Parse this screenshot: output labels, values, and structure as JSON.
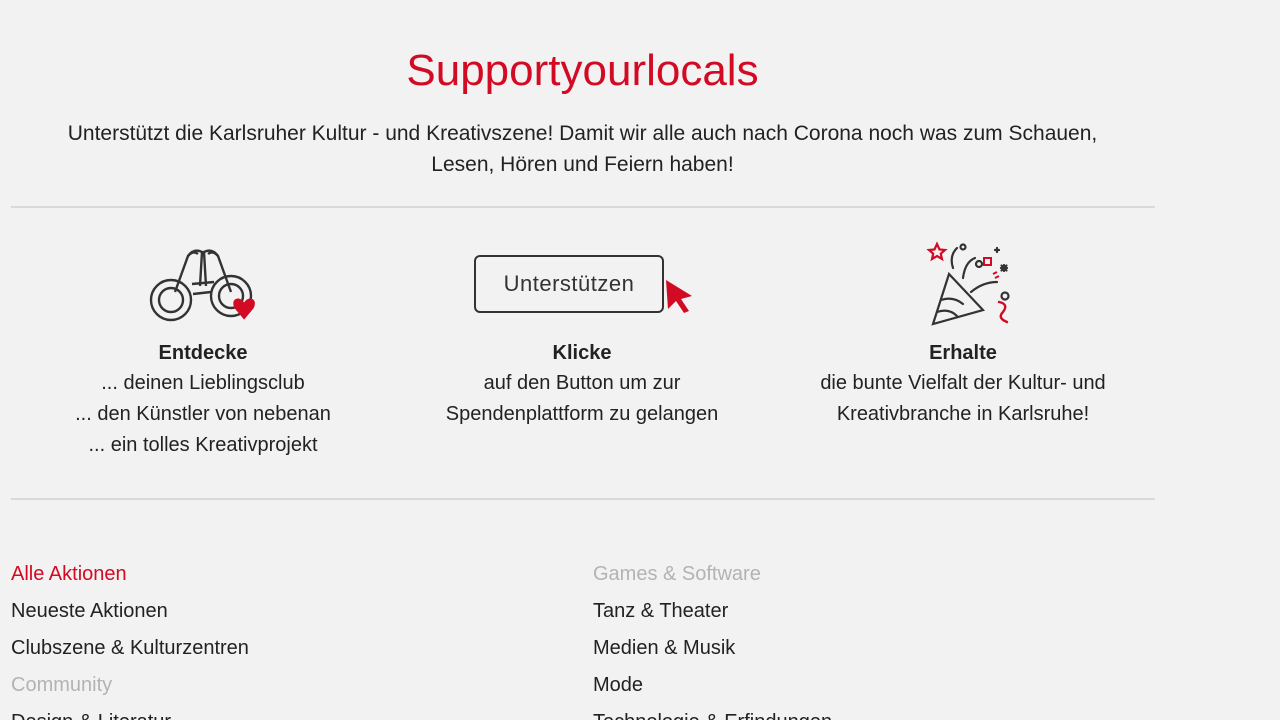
{
  "header": {
    "title": "Supportyourlocals",
    "subtitle_line1": "Unterstützt die Karlsruher Kultur - und Kreativszene! Damit wir alle auch nach Corona noch was zum Schauen,",
    "subtitle_line2": "Lesen, Hören und Feiern haben!"
  },
  "colors": {
    "accent": "#d20a23",
    "text": "#222222",
    "muted": "#b3b3b3",
    "background": "#f2f2f2"
  },
  "steps": [
    {
      "icon": "binoculars-heart-icon",
      "title": "Entdecke",
      "lines": [
        "... deinen Lieblingsclub",
        "... den Künstler von nebenan",
        "... ein tolles Kreativprojekt"
      ]
    },
    {
      "icon": "support-button-cursor-icon",
      "button_label": "Unterstützen",
      "title": "Klicke",
      "lines": [
        "auf den Button um zur",
        "Spendenplattform zu gelangen"
      ]
    },
    {
      "icon": "party-popper-icon",
      "title": "Erhalte",
      "lines": [
        "die bunte Vielfalt der Kultur- und",
        "Kreativbranche in Karlsruhe!"
      ]
    }
  ],
  "categories": {
    "left": [
      {
        "label": "Alle Aktionen",
        "state": "active"
      },
      {
        "label": "Neueste Aktionen",
        "state": "normal"
      },
      {
        "label": "Clubszene & Kulturzentren",
        "state": "normal"
      },
      {
        "label": "Community",
        "state": "muted"
      },
      {
        "label": "Design & Literatur",
        "state": "normal"
      }
    ],
    "right": [
      {
        "label": "Games & Software",
        "state": "muted"
      },
      {
        "label": "Tanz & Theater",
        "state": "normal"
      },
      {
        "label": "Medien & Musik",
        "state": "normal"
      },
      {
        "label": "Mode",
        "state": "normal"
      },
      {
        "label": "Technologie & Erfindungen",
        "state": "normal"
      }
    ]
  }
}
